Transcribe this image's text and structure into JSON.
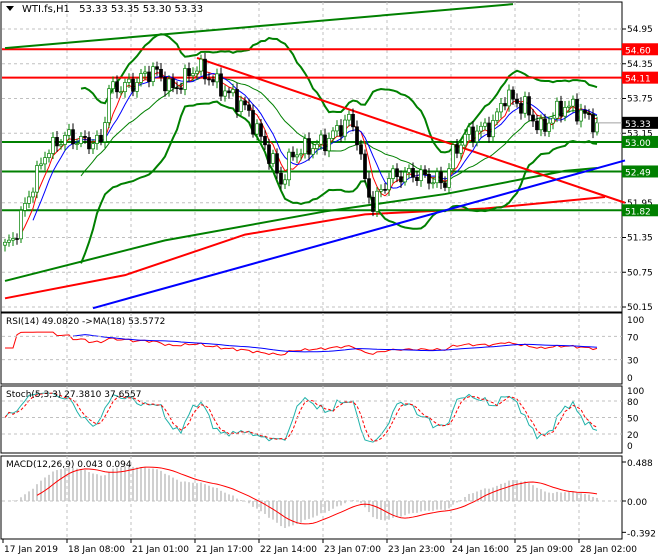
{
  "header": {
    "symbol": "WTI.fs,H1",
    "ohlc": "53.33 53.35 53.30 53.33"
  },
  "chart_data": [
    {
      "type": "candlestick",
      "title": "WTI.fs,H1 53.33 53.35 53.30 53.33",
      "ylim": [
        50.15,
        54.95
      ],
      "y_ticks": [
        "54.95",
        "54.35",
        "53.75",
        "53.15",
        "51.95",
        "51.35",
        "50.75",
        "50.15"
      ],
      "current_price": {
        "label": "53.33",
        "value": 53.33,
        "color": "#000000"
      },
      "levels": [
        {
          "label": "54.60",
          "value": 54.6,
          "color": "#ff0000"
        },
        {
          "label": "54.11",
          "value": 54.11,
          "color": "#ff0000"
        },
        {
          "label": "53.00",
          "value": 53.0,
          "color": "#008000"
        },
        {
          "label": "52.49",
          "value": 52.49,
          "color": "#008000"
        },
        {
          "label": "51.82",
          "value": 51.82,
          "color": "#008000"
        }
      ],
      "x_ticks": [
        "17 Jan 2019",
        "18 Jan 08:00",
        "21 Jan 01:00",
        "21 Jan 17:00",
        "22 Jan 14:00",
        "23 Jan 07:00",
        "23 Jan 23:00",
        "24 Jan 16:00",
        "25 Jan 09:00",
        "28 Jan 02:00"
      ],
      "bars_per_tick": 16,
      "close_keypoints": [
        [
          0,
          51.2
        ],
        [
          2,
          51.3
        ],
        [
          5,
          51.9
        ],
        [
          10,
          52.8
        ],
        [
          15,
          53.1
        ],
        [
          20,
          53.0
        ],
        [
          24,
          53.0
        ],
        [
          26,
          53.9
        ],
        [
          32,
          54.0
        ],
        [
          37,
          54.25
        ],
        [
          42,
          53.9
        ],
        [
          48,
          54.3
        ],
        [
          53,
          54.0
        ],
        [
          60,
          53.6
        ],
        [
          66,
          52.8
        ],
        [
          69,
          52.3
        ],
        [
          72,
          52.8
        ],
        [
          80,
          53.0
        ],
        [
          86,
          53.4
        ],
        [
          88,
          53.1
        ],
        [
          90,
          52.3
        ],
        [
          92,
          51.9
        ],
        [
          96,
          52.4
        ],
        [
          102,
          52.45
        ],
        [
          110,
          52.3
        ],
        [
          112,
          52.8
        ],
        [
          115,
          53.1
        ],
        [
          122,
          53.3
        ],
        [
          125,
          53.8
        ],
        [
          130,
          53.6
        ],
        [
          134,
          53.2
        ],
        [
          139,
          53.6
        ],
        [
          142,
          53.6
        ],
        [
          146,
          53.4
        ],
        [
          148,
          53.33
        ]
      ],
      "long_ma": [
        {
          "name": "MA green",
          "color": "#008000",
          "points": [
            [
              0,
              50.6
            ],
            [
              40,
              51.3
            ],
            [
              80,
              51.8
            ],
            [
              110,
              52.1
            ],
            [
              140,
              52.5
            ],
            [
              148,
              52.55
            ]
          ]
        },
        {
          "name": "MA red",
          "color": "#ff0000",
          "points": [
            [
              0,
              50.3
            ],
            [
              30,
              50.7
            ],
            [
              60,
              51.4
            ],
            [
              90,
              51.75
            ],
            [
              120,
              51.85
            ],
            [
              150,
              52.05
            ]
          ]
        }
      ],
      "trendlines": [
        {
          "color": "#008000",
          "from": [
            0,
            54.62
          ],
          "to": [
            127,
            55.38
          ]
        },
        {
          "color": "#ff0000",
          "from": [
            48,
            54.45
          ],
          "to": [
            155,
            51.95
          ]
        },
        {
          "color": "#0000ff",
          "from": [
            22,
            50.13
          ],
          "to": [
            155,
            52.68
          ]
        }
      ]
    },
    {
      "type": "line",
      "title": "RSI(14) 49.0820 ->MA(18) 53.5772",
      "ylim": [
        0,
        100
      ],
      "y_ticks": [
        "100",
        "70",
        "30",
        "0"
      ],
      "series": [
        {
          "name": "RSI(14)",
          "color": "#ff0000"
        },
        {
          "name": "MA(18)",
          "color": "#0000ff"
        }
      ]
    },
    {
      "type": "line",
      "title": "Stoch(5,3,3) 27.3810 37.6557",
      "ylim": [
        0,
        100
      ],
      "y_ticks": [
        "100",
        "80",
        "50",
        "20",
        "0"
      ],
      "series": [
        {
          "name": "%K",
          "color": "#20b2aa"
        },
        {
          "name": "%D",
          "color": "#ff0000"
        }
      ]
    },
    {
      "type": "bar",
      "title": "MACD(12,26,9) 0.043 0.094",
      "ylim": [
        -0.392,
        0.488
      ],
      "y_ticks": [
        "0.488",
        "0.00",
        "-0.392"
      ],
      "series": [
        {
          "name": "MACD",
          "color": "#c0c0c0"
        },
        {
          "name": "Signal",
          "color": "#ff0000"
        }
      ]
    }
  ]
}
